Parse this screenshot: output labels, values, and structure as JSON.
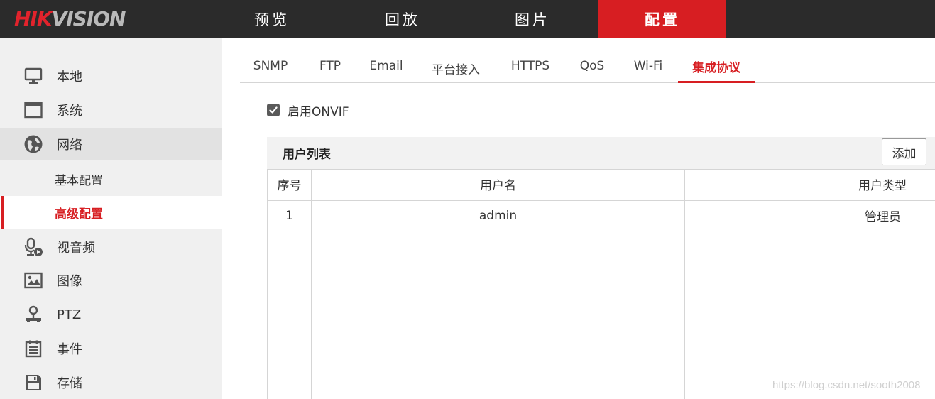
{
  "header": {
    "logo_part1": "HIK",
    "logo_part2": "VISION",
    "nav": [
      {
        "label": "预览"
      },
      {
        "label": "回放"
      },
      {
        "label": "图片"
      },
      {
        "label": "配置",
        "active": true
      }
    ]
  },
  "sidebar": {
    "items": [
      {
        "label": "本地",
        "icon": "monitor-icon"
      },
      {
        "label": "系统",
        "icon": "window-icon"
      },
      {
        "label": "网络",
        "icon": "globe-icon"
      },
      {
        "label": "视音频",
        "icon": "microphone-video-icon"
      },
      {
        "label": "图像",
        "icon": "image-icon"
      },
      {
        "label": "PTZ",
        "icon": "joystick-icon"
      },
      {
        "label": "事件",
        "icon": "calendar-list-icon"
      },
      {
        "label": "存储",
        "icon": "floppy-disk-icon"
      }
    ],
    "network_sub": [
      {
        "label": "基本配置"
      },
      {
        "label": "高级配置",
        "active": true
      }
    ]
  },
  "tabs": [
    {
      "label": "SNMP"
    },
    {
      "label": "FTP"
    },
    {
      "label": "Email"
    },
    {
      "label": "平台接入"
    },
    {
      "label": "HTTPS"
    },
    {
      "label": "QoS"
    },
    {
      "label": "Wi-Fi"
    },
    {
      "label": "集成协议",
      "active": true
    }
  ],
  "onvif": {
    "label": "启用ONVIF",
    "checked": true
  },
  "user_list": {
    "title": "用户列表",
    "add_label": "添加",
    "columns": [
      "序号",
      "用户名",
      "用户类型"
    ],
    "rows": [
      [
        "1",
        "admin",
        "管理员"
      ]
    ]
  },
  "watermark": "https://blog.csdn.net/sooth2008",
  "colors": {
    "accent": "#d71e22",
    "topbar": "#2b2b2b",
    "sidebar": "#f0f0f0"
  }
}
